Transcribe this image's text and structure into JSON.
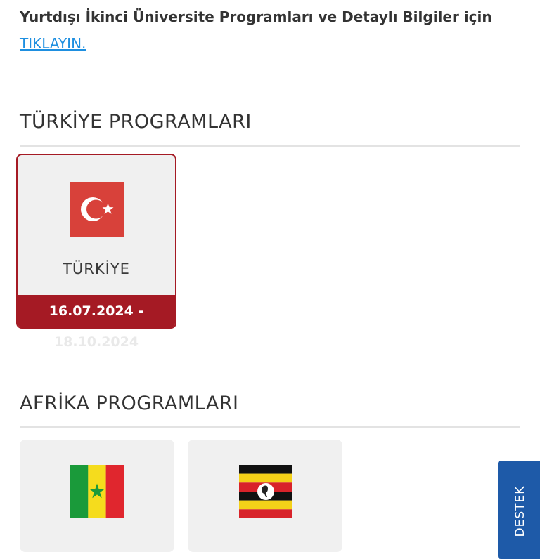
{
  "intro": {
    "text": "Yurtdışı İkinci Üniversite Programları ve Detaylı Bilgiler için",
    "link_label": "TIKLAYIN."
  },
  "sections": [
    {
      "title": "TÜRKİYE PROGRAMLARI",
      "cards": [
        {
          "name": "TÜRKİYE",
          "flag": "turkey-flag",
          "dates": "16.07.2024 -",
          "end_date": "18.10.2024",
          "accent": "#a51a24"
        }
      ]
    },
    {
      "title": "AFRİKA PROGRAMLARI",
      "cards": [
        {
          "flag": "senegal-flag"
        },
        {
          "flag": "uganda-flag"
        }
      ]
    }
  ],
  "support_tab": {
    "label": "DESTEK",
    "color": "#1e5aa8"
  },
  "colors": {
    "link": "#1e8fe0",
    "card_bg": "#f0f0f0",
    "turkey_red": "#d8413a"
  }
}
